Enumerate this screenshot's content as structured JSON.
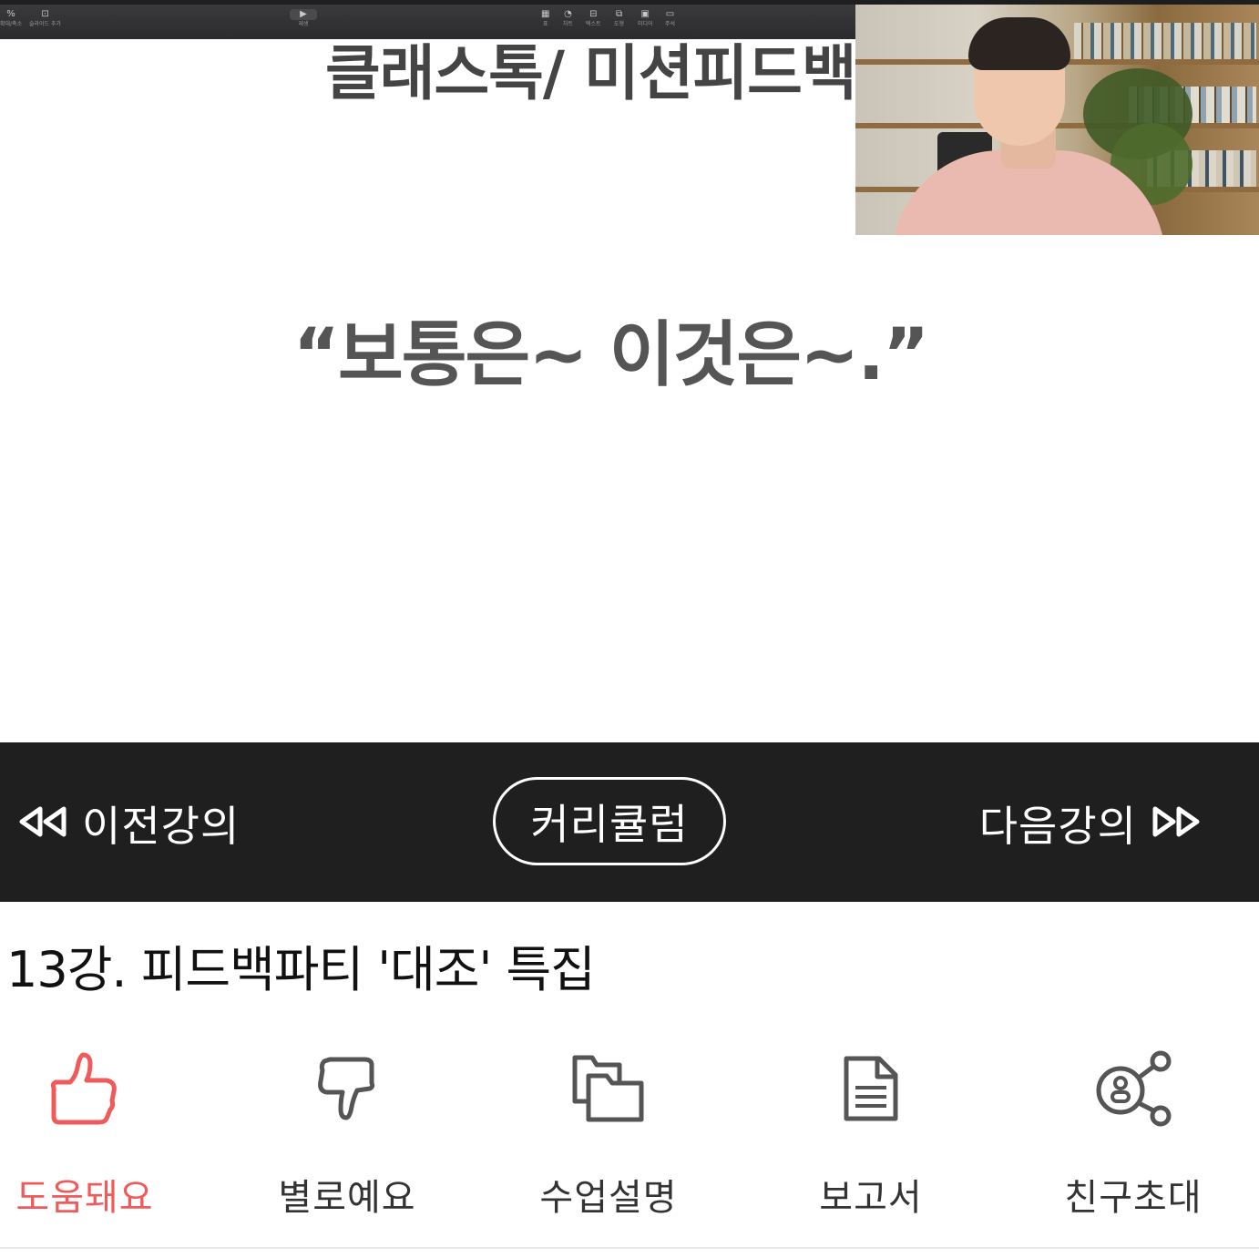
{
  "colors": {
    "nav_background": "#1f1f1f",
    "accent_red": "#ef5b5b",
    "icon_gray": "#555555",
    "slide_text": "#555555"
  },
  "keynote_toolbar": {
    "zoom": "%",
    "items": [
      {
        "label": "확대/축소",
        "icon": "zoom-icon"
      },
      {
        "label": "슬라이드 추가",
        "icon": "add-slide-icon"
      },
      {
        "label": "재생",
        "icon": "play-icon"
      },
      {
        "label": "표",
        "icon": "table-icon"
      },
      {
        "label": "차트",
        "icon": "chart-icon"
      },
      {
        "label": "텍스트",
        "icon": "text-icon"
      },
      {
        "label": "도형",
        "icon": "shape-icon"
      },
      {
        "label": "미디어",
        "icon": "media-icon"
      },
      {
        "label": "주석",
        "icon": "comment-icon"
      }
    ]
  },
  "slide": {
    "title": "클래스톡/ 미션피드백",
    "quote": "“보통은~ 이것은~.”"
  },
  "nav": {
    "prev_label": "이전강의",
    "curriculum_label": "커리큘럼",
    "next_label": "다음강의"
  },
  "lecture": {
    "title": "13강. 피드백파티 '대조' 특집"
  },
  "actions": [
    {
      "label": "도움돼요",
      "icon": "thumbs-up-icon",
      "active": true
    },
    {
      "label": "별로예요",
      "icon": "thumbs-down-icon",
      "active": false
    },
    {
      "label": "수업설명",
      "icon": "folders-icon",
      "active": false
    },
    {
      "label": "보고서",
      "icon": "document-icon",
      "active": false
    },
    {
      "label": "친구초대",
      "icon": "share-icon",
      "active": false
    }
  ]
}
